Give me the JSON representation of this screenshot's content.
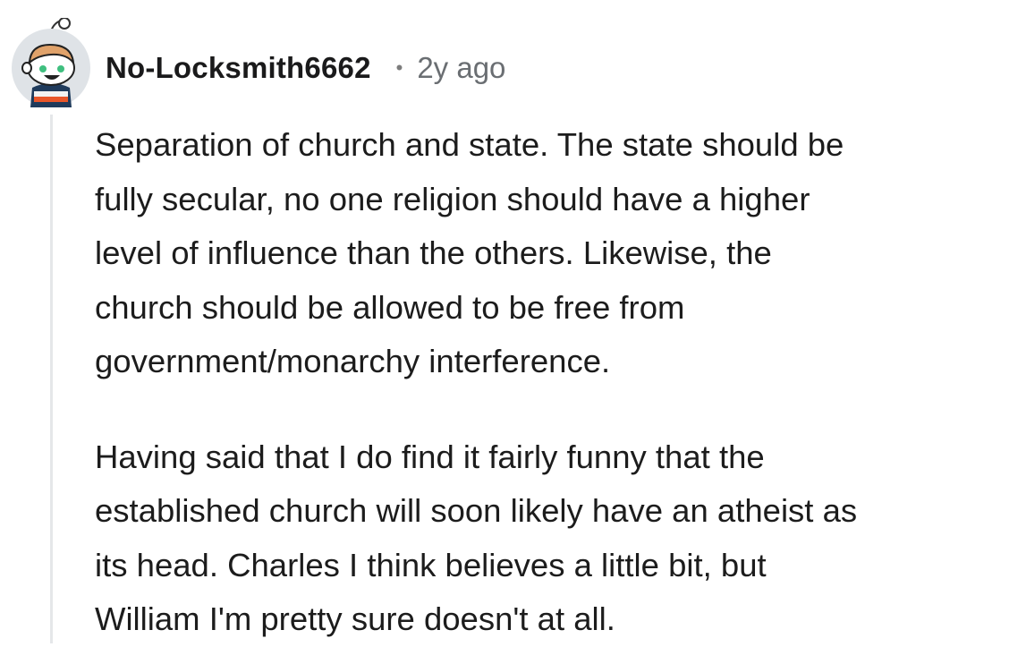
{
  "comment": {
    "author": "No-Locksmith6662",
    "separator": "•",
    "timestamp": "2y ago",
    "paragraphs": [
      {
        "lines": [
          "Separation of church and state. The state should be",
          "fully secular, no one religion should have a higher",
          "level of influence than the others. Likewise, the",
          "church should be allowed to be free from",
          "government/monarchy interference."
        ]
      },
      {
        "lines": [
          "Having said that I do find it fairly funny that the",
          "established church will soon likely have an atheist as",
          "its head. Charles I think believes a little bit, but",
          "William I'm pretty sure doesn't at all."
        ]
      }
    ]
  },
  "colors": {
    "avatar_background": "#dfe3e7",
    "thread_line": "#e5e7e9",
    "username": "#1a1a1b",
    "timestamp": "#6a6e72"
  },
  "icons": {
    "avatar": "snoo-avatar-icon"
  }
}
